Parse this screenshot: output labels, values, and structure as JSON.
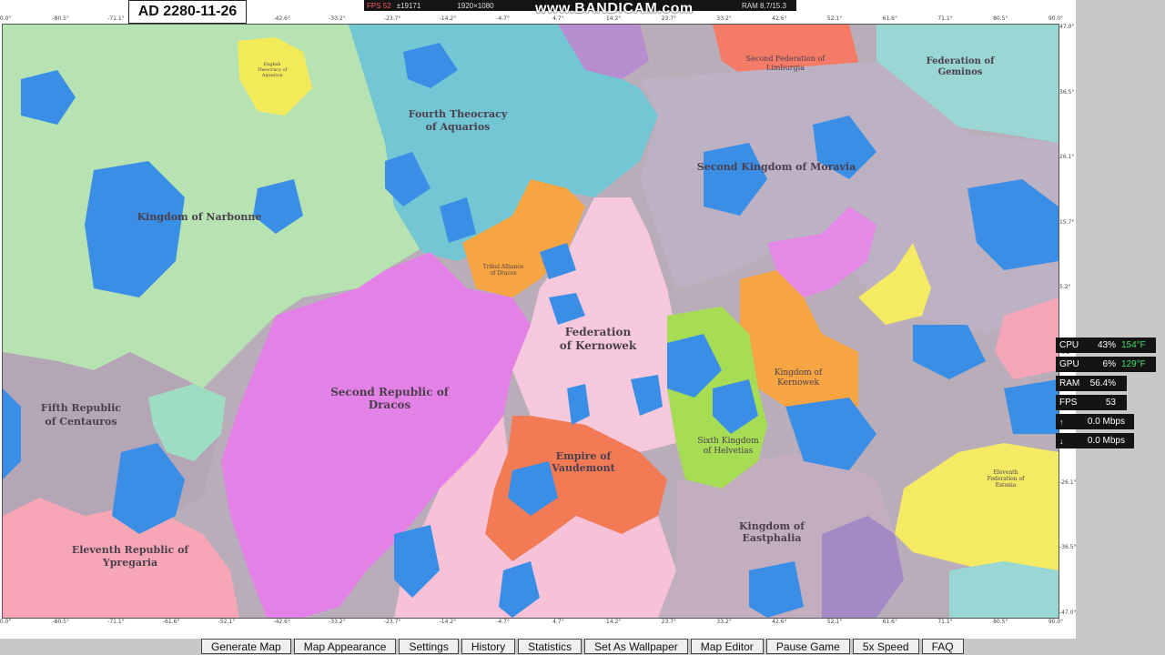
{
  "date": "AD 2280-11-26",
  "recorder": {
    "fps": "FPS 52",
    "counter": "±19171",
    "resolution": "1920×1080",
    "brand": "www.BANDICAM.com",
    "ram": "RAM 8.7/15.3"
  },
  "axis": {
    "top": [
      "0.0°",
      "-80.5°",
      "-71.1°",
      "-61.6°",
      "-52.1°",
      "-42.6°",
      "-33.2°",
      "-23.7°",
      "-14.2°",
      "-4.7°",
      "4.7°",
      "14.2°",
      "23.7°",
      "33.2°",
      "42.6°",
      "52.1°",
      "61.6°",
      "71.1°",
      "80.5°",
      "90.0°"
    ],
    "bottom": [
      "0.0°",
      "-80.5°",
      "-71.1°",
      "-61.6°",
      "-52.1°",
      "-42.6°",
      "-33.2°",
      "-23.7°",
      "-14.2°",
      "-4.7°",
      "4.7°",
      "14.2°",
      "23.7°",
      "33.2°",
      "42.6°",
      "52.1°",
      "61.6°",
      "71.1°",
      "80.5°",
      "90.0°"
    ],
    "right": [
      "47.0°",
      "36.5°",
      "26.1°",
      "15.7°",
      "5.2°",
      "-5.2°",
      "-15.7°",
      "-26.1°",
      "-36.5°",
      "-47.0°"
    ]
  },
  "map": {
    "labels": {
      "narbonne": "Kingdom of Narbonne",
      "aquarios_1": "Fourth Theocracy",
      "aquarios_2": "of Aquarios",
      "moravia": "Second Kingdom of Moravia",
      "limburgia_1": "Second Federation of",
      "limburgia_2": "Limburgia",
      "geminos_1": "Federation of",
      "geminos_2": "Geminos",
      "kernowek_fed_1": "Federation",
      "kernowek_fed_2": "of Kernowek",
      "dracos_1": "Second Republic of",
      "dracos_2": "Dracos",
      "centauros_1": "Fifth Republic",
      "centauros_2": "of Centauros",
      "vaudemont_1": "Empire of",
      "vaudemont_2": "Vaudemont",
      "kernowek_kgd_1": "Kingdom of",
      "kernowek_kgd_2": "Kernowek",
      "helvetias_1": "Sixth Kingdom",
      "helvetias_2": "of Helvetias",
      "eastphalia_1": "Kingdom of",
      "eastphalia_2": "Eastphalia",
      "ypregaria_1": "Eleventh Republic of",
      "ypregaria_2": "Ypregaria",
      "tribal_dracos_1": "Tribal Alliance",
      "tribal_dracos_2": "of Dracos",
      "eleventh_fed_1": "Eleventh",
      "eleventh_fed_2": "Federation of",
      "eleventh_fed_3": "Estonia",
      "english_theocracy_1": "English",
      "english_theocracy_2": "Theocracy of",
      "english_theocracy_3": "Aquarios"
    }
  },
  "hardware": {
    "cpu": {
      "label": "CPU",
      "value": "43%",
      "temp": "154°F"
    },
    "gpu": {
      "label": "GPU",
      "value": "6%",
      "temp": "129°F"
    },
    "ram": {
      "label": "RAM",
      "value": "56.4%"
    },
    "fps": {
      "label": "FPS",
      "value": "53"
    },
    "up": {
      "icon": "↑",
      "value": "0.0 Mbps"
    },
    "down": {
      "icon": "↓",
      "value": "0.0 Mbps"
    }
  },
  "toolbar": {
    "generate_map": "Generate Map",
    "map_appearance": "Map Appearance",
    "settings": "Settings",
    "history": "History",
    "statistics": "Statistics",
    "set_as_wallpaper": "Set As Wallpaper",
    "map_editor": "Map Editor",
    "pause_game": "Pause Game",
    "speed": "5x Speed",
    "faq": "FAQ"
  }
}
